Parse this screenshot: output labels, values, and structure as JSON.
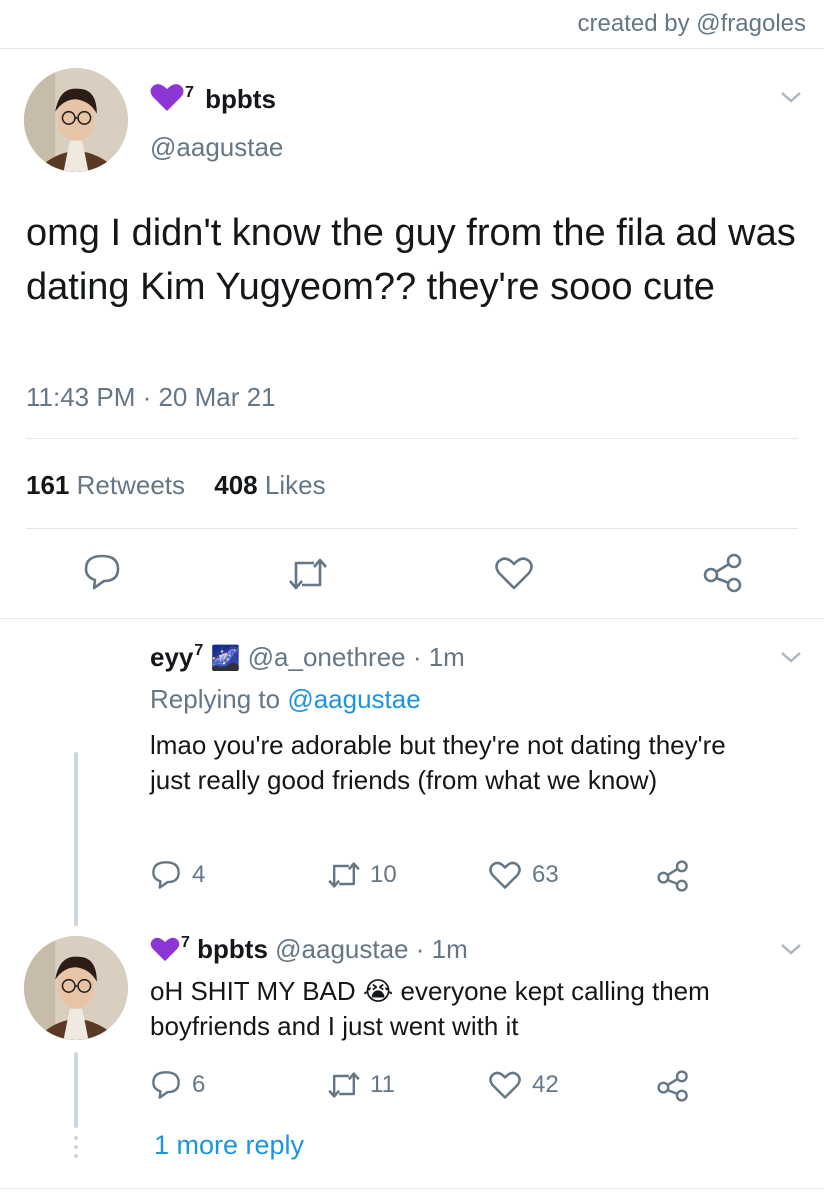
{
  "watermark": "created by @fragoles",
  "main_tweet": {
    "badge": "💜",
    "sup": "7",
    "display_name": "bpbts",
    "handle": "@aagustae",
    "text": "omg I didn't know the guy from the fila ad was dating Kim Yugyeom?? they're sooo cute",
    "timestamp": "11:43 PM · 20 Mar 21",
    "retweets_count": "161",
    "retweets_label": "Retweets",
    "likes_count": "408",
    "likes_label": "Likes",
    "actions": [
      "reply-icon",
      "retweet-icon",
      "like-icon",
      "share-icon"
    ]
  },
  "replies": [
    {
      "display_name": "eyy",
      "sup": "7",
      "emoji": "🌌",
      "handle_time": "@a_onethree · 1m",
      "replying_prefix": "Replying to",
      "replying_to": "@aagustae",
      "text": "lmao you're adorable but they're not dating they're just really good friends (from what we know)",
      "reply_count": "4",
      "retweet_count": "10",
      "like_count": "63"
    },
    {
      "badge": "💜",
      "sup": "7",
      "display_name": "bpbts",
      "handle_time": "@aagustae · 1m",
      "text_before": "oH SHIT MY BAD",
      "emoji": "😭",
      "text_after": "everyone kept calling them boyfriends and I just went with it",
      "reply_count": "6",
      "retweet_count": "11",
      "like_count": "42"
    }
  ],
  "more_replies": "1 more reply",
  "colors": {
    "text": "#14171a",
    "secondary": "#657786",
    "link": "#1b95e0",
    "divider": "#e1e8ed",
    "thread": "#ccd6dd",
    "heart_badge": "#8e35d6"
  }
}
